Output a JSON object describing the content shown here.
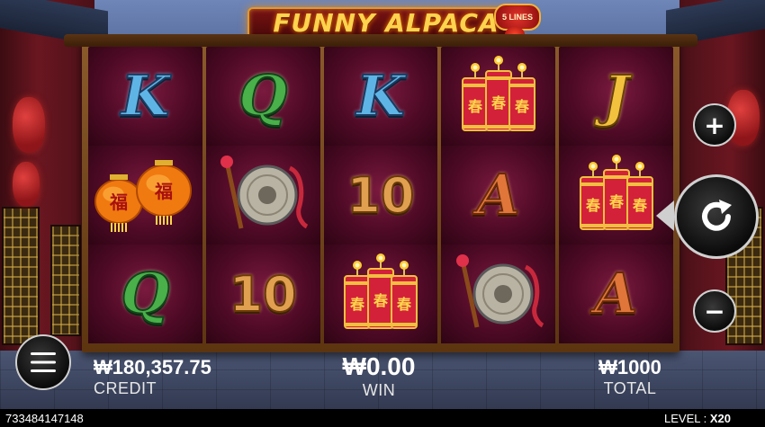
{
  "game": {
    "title": "FUNNY ALPACA",
    "lines_badge": "5 LINES"
  },
  "reels": [
    [
      "K",
      "gold-lanterns",
      "Q"
    ],
    [
      "Q",
      "gong",
      "10"
    ],
    [
      "K",
      "10",
      "firecrackers"
    ],
    [
      "firecrackers",
      "A",
      "gong"
    ],
    [
      "J",
      "firecrackers",
      "A"
    ]
  ],
  "symbols": {
    "K": "K",
    "Q": "Q",
    "J": "J",
    "A": "A",
    "10": "10",
    "lantern_char": "福",
    "firecracker_char": "春"
  },
  "panel": {
    "credit_value": "₩180,357.75",
    "credit_label": "CREDIT",
    "win_value": "₩0.00",
    "win_label": "WIN",
    "total_value": "₩1000",
    "total_label": "TOTAL"
  },
  "controls": {
    "plus_label": "+",
    "minus_label": "−"
  },
  "footer": {
    "session_id": "733484147148",
    "level_label": "LEVEL :",
    "level_value": "X20"
  },
  "colors": {
    "reel_bg": "#4e0a25",
    "K": "#5fb4e6",
    "Q": "#49b04a",
    "J": "#f2c23e",
    "A": "#e0763a",
    "ten": "#e0a050"
  }
}
